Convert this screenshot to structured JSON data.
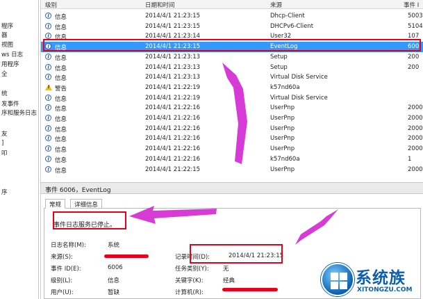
{
  "tree": {
    "items": [
      "程序",
      "器",
      "视图",
      "ws 日志",
      "用程序",
      "全",
      "统",
      "发事件",
      "序和服务日志",
      "友",
      "]",
      "叩",
      "序"
    ]
  },
  "columns": {
    "level": "级别",
    "datetime": "日期和时间",
    "source": "来源",
    "event_id": "事件 I"
  },
  "events": [
    {
      "level": "信息",
      "icon": "info-icon",
      "datetime": "2014/4/1 21:23:15",
      "source": "Dhcp-Client",
      "event_id": "5003",
      "selected": false
    },
    {
      "level": "信息",
      "icon": "info-icon",
      "datetime": "2014/4/1 21:23:15",
      "source": "DHCPv6-Client",
      "event_id": "5104",
      "selected": false
    },
    {
      "level": "信息",
      "icon": "info-icon",
      "datetime": "2014/4/1 21:23:14",
      "source": "User32",
      "event_id": "107",
      "selected": false
    },
    {
      "level": "信息",
      "icon": "info-icon",
      "datetime": "2014/4/1 21:23:15",
      "source": "EventLog",
      "event_id": "600",
      "selected": true
    },
    {
      "level": "信息",
      "icon": "info-icon",
      "datetime": "2014/4/1 21:23:13",
      "source": "Setup",
      "event_id": "200",
      "selected": false
    },
    {
      "level": "信息",
      "icon": "info-icon",
      "datetime": "2014/4/1 21:23:13",
      "source": "Setup",
      "event_id": "200",
      "selected": false
    },
    {
      "level": "信息",
      "icon": "info-icon",
      "datetime": "2014/4/1 21:23:13",
      "source": "Virtual Disk Service",
      "event_id": "",
      "selected": false
    },
    {
      "level": "警告",
      "icon": "warning-icon",
      "datetime": "2014/4/1 21:22:19",
      "source": "k57nd60a",
      "event_id": "",
      "selected": false
    },
    {
      "level": "信息",
      "icon": "info-icon",
      "datetime": "2014/4/1 21:22:19",
      "source": "Virtual Disk Service",
      "event_id": "",
      "selected": false
    },
    {
      "level": "信息",
      "icon": "info-icon",
      "datetime": "2014/4/1 21:22:16",
      "source": "UserPnp",
      "event_id": "2000",
      "selected": false
    },
    {
      "level": "信息",
      "icon": "info-icon",
      "datetime": "2014/4/1 21:22:16",
      "source": "UserPnp",
      "event_id": "2000",
      "selected": false
    },
    {
      "level": "信息",
      "icon": "info-icon",
      "datetime": "2014/4/1 21:22:16",
      "source": "UserPnp",
      "event_id": "2000",
      "selected": false
    },
    {
      "level": "信息",
      "icon": "info-icon",
      "datetime": "2014/4/1 21:22:16",
      "source": "UserPnp",
      "event_id": "2000",
      "selected": false
    },
    {
      "level": "信息",
      "icon": "info-icon",
      "datetime": "2014/4/1 21:22:16",
      "source": "UserPnp",
      "event_id": "2000",
      "selected": false
    },
    {
      "level": "信息",
      "icon": "info-icon",
      "datetime": "2014/4/1 21:22:16",
      "source": "k57nd60a",
      "event_id": "1",
      "selected": false
    },
    {
      "level": "信息",
      "icon": "info-icon",
      "datetime": "2014/4/1 21:22:15",
      "source": "UserPnp",
      "event_id": "2000",
      "selected": false
    }
  ],
  "detail": {
    "title": "事件 6006，EventLog",
    "tabs": [
      "常规",
      "详细信息"
    ],
    "message": "事件日志服务已停止。",
    "fields": {
      "log_name_label": "日志名称(M):",
      "log_name": "系统",
      "source_label": "来源(S):",
      "logged_label": "记录时间(D):",
      "logged": "2014/4/1 21:23:15",
      "event_id_label": "事件 ID(E):",
      "event_id": "6006",
      "task_label": "任务类别(Y):",
      "task": "无",
      "level_label": "级别(L):",
      "level": "信息",
      "keywords_label": "关键字(K):",
      "keywords": "经典",
      "user_label": "用户(U):",
      "user": "暂缺",
      "computer_label": "计算机(R):"
    }
  },
  "watermark": {
    "brand": "系统族",
    "url": "XITONGZU.COM"
  },
  "colors": {
    "selection": "#3399ff",
    "annotation": "#e2001a",
    "arrow": "#d63bd6",
    "brand": "#0b5fae"
  }
}
